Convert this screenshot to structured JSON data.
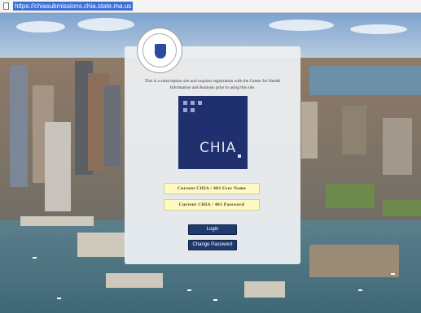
{
  "browser": {
    "url": "https://chiasubmissions.chia.state.ma.us"
  },
  "login": {
    "intro_line1": "This is a subscription site and requires registration with the Center for Health",
    "intro_line2": "Information and Analysis prior to using this site.",
    "logo_text": "CHIA",
    "username_label": "Current CHIA / 403 User Name",
    "password_label": "Current CHIA / 403 Password",
    "login_button": "Login",
    "change_password_button": "Change Password"
  },
  "colors": {
    "brand": "#20306f",
    "button": "#1f3a6e",
    "field": "#fff9c2"
  }
}
